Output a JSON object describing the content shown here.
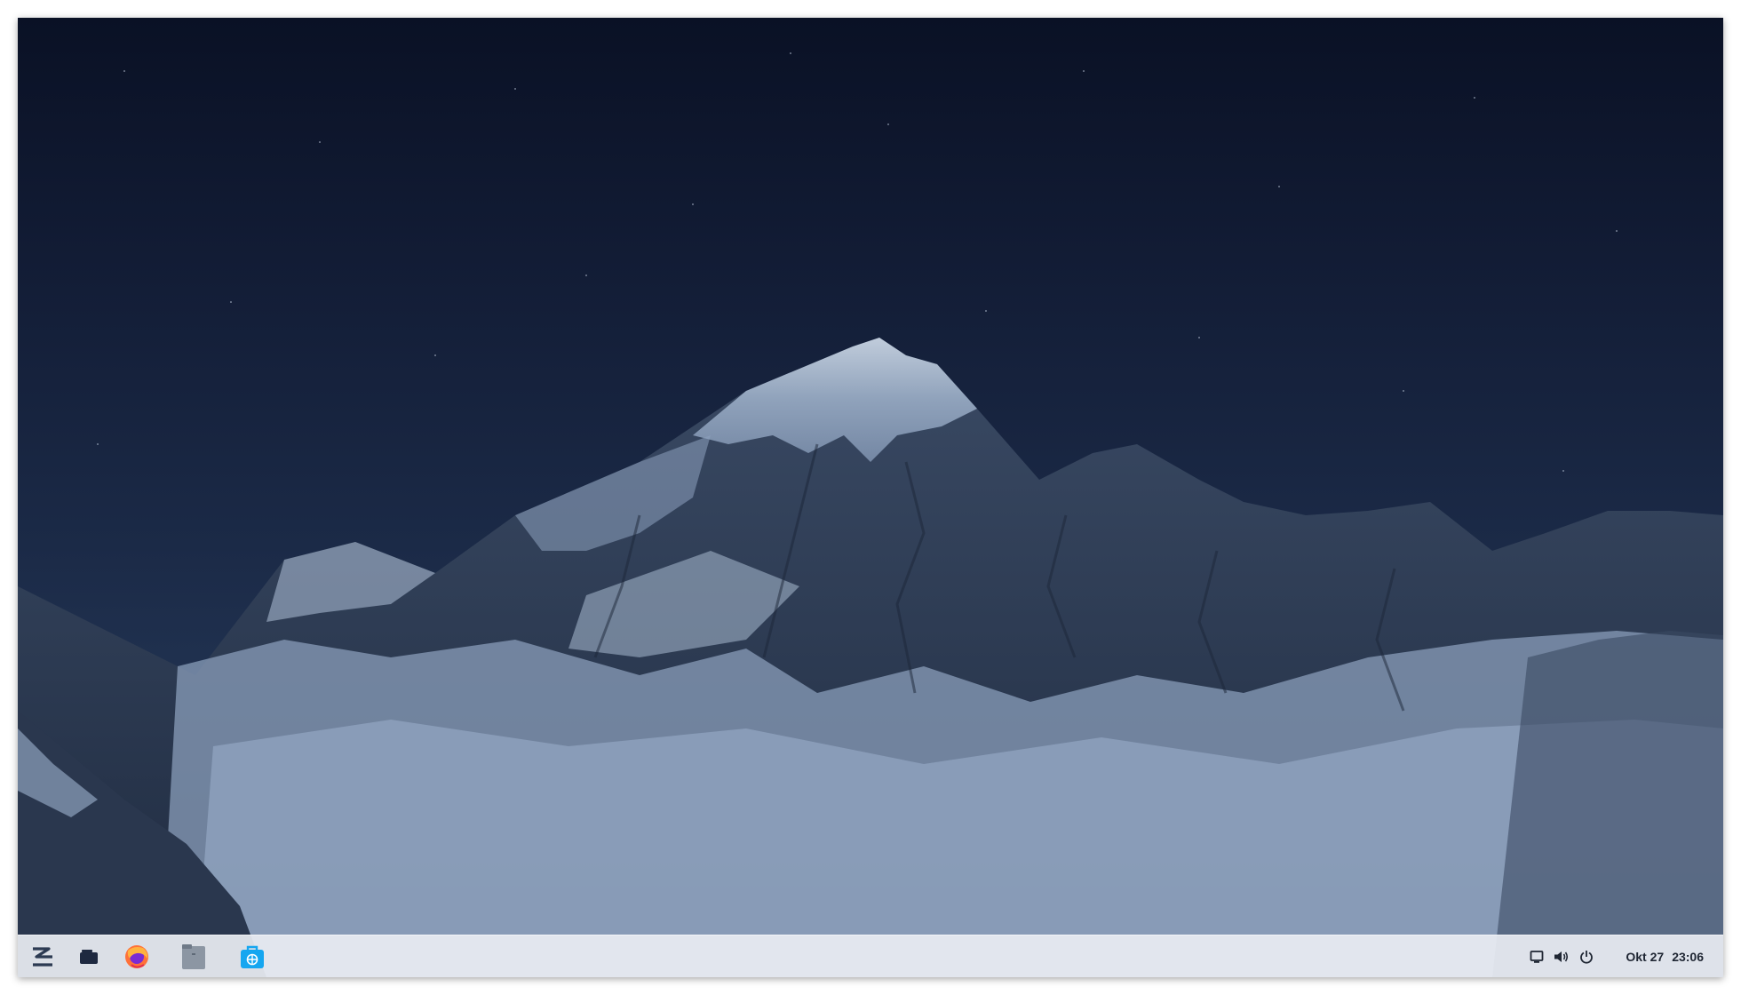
{
  "desktop": {
    "wallpaper": "mountain-night-wallpaper"
  },
  "taskbar": {
    "items": [
      {
        "name": "zorin-menu-icon"
      },
      {
        "name": "workspaces-icon"
      },
      {
        "name": "firefox-icon"
      },
      {
        "name": "files-icon"
      },
      {
        "name": "software-store-icon"
      }
    ],
    "tray": {
      "icons": [
        "display-icon",
        "volume-icon",
        "power-icon"
      ]
    },
    "clock": {
      "date": "Okt 27",
      "time": "23:06"
    },
    "colors": {
      "bar": "#e8ecf2",
      "accent": "#15a6f0",
      "firefox": "#ff7139"
    }
  }
}
